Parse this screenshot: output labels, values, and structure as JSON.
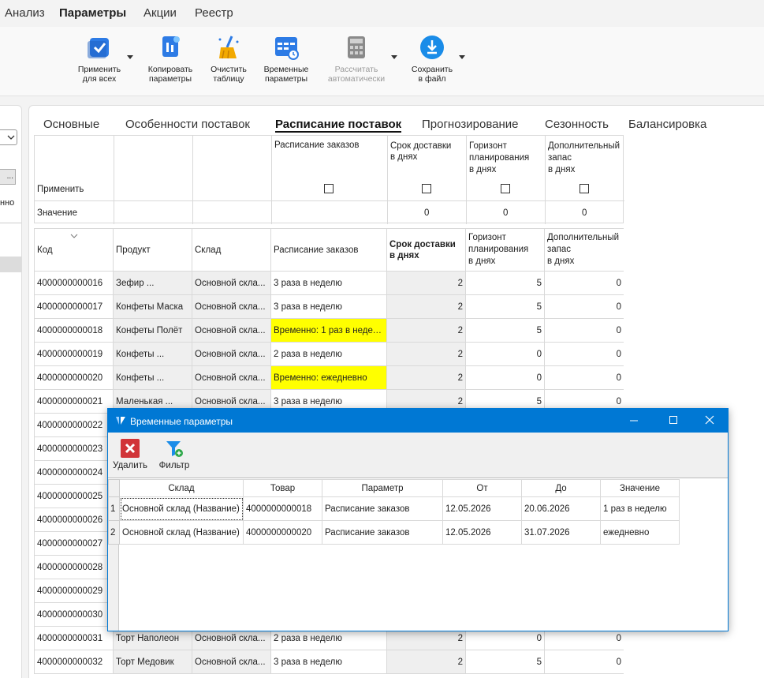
{
  "menu": [
    "Анализ",
    "Параметры",
    "Акции",
    "Реестр"
  ],
  "ribbon": {
    "apply_all": "Применить\nдля всех",
    "copy_params": "Копировать\nпараметры",
    "clear_table": "Очистить\nтаблицу",
    "temp_params": "Временные\nпараметры",
    "calc_auto": "Рассчитать\nавтоматически",
    "save_file": "Сохранить\nв файл"
  },
  "left_panel": {
    "partial_text": "нно"
  },
  "tabs": [
    "Основные",
    "Особенности поставок",
    "Расписание поставок",
    "Прогнозирование",
    "Сезонность",
    "Балансировка"
  ],
  "apply_grid": {
    "col_order_schedule": "Расписание заказов",
    "col_delivery": "Срок доставки\nв днях",
    "col_horizon": "Горизонт\nпланирования\nв днях",
    "col_extra": "Дополнительный\nзапас\nв днях",
    "row_apply": "Применить",
    "row_value": "Значение",
    "values": [
      "0",
      "0",
      "0"
    ]
  },
  "table": {
    "headers": [
      "Код",
      "Продукт",
      "Склад",
      "Расписание заказов",
      "Срок доставки\nв днях",
      "Горизонт\nпланирования\nв днях",
      "Дополнительный\nзапас\nв днях"
    ],
    "rows": [
      {
        "code": "4000000000016",
        "product": "Зефир ...",
        "wh": "Основной скла...",
        "sched": "3 раза в неделю",
        "d": "2",
        "h": "5",
        "e": "0",
        "hl": false
      },
      {
        "code": "4000000000017",
        "product": "Конфеты Маска",
        "wh": "Основной скла...",
        "sched": "3 раза в неделю",
        "d": "2",
        "h": "5",
        "e": "0",
        "hl": false
      },
      {
        "code": "4000000000018",
        "product": "Конфеты Полёт",
        "wh": "Основной скла...",
        "sched": "Временно: 1 раз в неделю",
        "d": "2",
        "h": "5",
        "e": "0",
        "hl": true
      },
      {
        "code": "4000000000019",
        "product": "Конфеты ...",
        "wh": "Основной скла...",
        "sched": "2 раза в неделю",
        "d": "2",
        "h": "0",
        "e": "0",
        "hl": false
      },
      {
        "code": "4000000000020",
        "product": "Конфеты ...",
        "wh": "Основной скла...",
        "sched": "Временно: ежедневно",
        "d": "2",
        "h": "0",
        "e": "0",
        "hl": true
      },
      {
        "code": "4000000000021",
        "product": "Маленькая ...",
        "wh": "Основной скла...",
        "sched": "3 раза в неделю",
        "d": "2",
        "h": "5",
        "e": "0",
        "hl": false
      },
      {
        "code": "4000000000022",
        "product": "",
        "wh": "",
        "sched": "",
        "d": "",
        "h": "",
        "e": "",
        "hl": false
      },
      {
        "code": "4000000000023",
        "product": "",
        "wh": "",
        "sched": "",
        "d": "",
        "h": "",
        "e": "",
        "hl": false
      },
      {
        "code": "4000000000024",
        "product": "",
        "wh": "",
        "sched": "",
        "d": "",
        "h": "",
        "e": "",
        "hl": false
      },
      {
        "code": "4000000000025",
        "product": "",
        "wh": "",
        "sched": "",
        "d": "",
        "h": "",
        "e": "",
        "hl": false
      },
      {
        "code": "4000000000026",
        "product": "",
        "wh": "",
        "sched": "",
        "d": "",
        "h": "",
        "e": "",
        "hl": false
      },
      {
        "code": "4000000000027",
        "product": "",
        "wh": "",
        "sched": "",
        "d": "",
        "h": "",
        "e": "",
        "hl": false
      },
      {
        "code": "4000000000028",
        "product": "",
        "wh": "",
        "sched": "",
        "d": "",
        "h": "",
        "e": "",
        "hl": false
      },
      {
        "code": "4000000000029",
        "product": "",
        "wh": "",
        "sched": "",
        "d": "",
        "h": "",
        "e": "",
        "hl": false
      },
      {
        "code": "4000000000030",
        "product": "",
        "wh": "",
        "sched": "",
        "d": "",
        "h": "",
        "e": "",
        "hl": false
      },
      {
        "code": "4000000000031",
        "product": "Торт Наполеон",
        "wh": "Основной скла...",
        "sched": "2 раза в неделю",
        "d": "2",
        "h": "0",
        "e": "0",
        "hl": false
      },
      {
        "code": "4000000000032",
        "product": "Торт Медовик",
        "wh": "Основной скла...",
        "sched": "3 раза в неделю",
        "d": "2",
        "h": "5",
        "e": "0",
        "hl": false
      }
    ]
  },
  "dialog": {
    "title": "Временные параметры",
    "delete": "Удалить",
    "filter": "Фильтр",
    "headers": [
      "Склад",
      "Товар",
      "Параметр",
      "От",
      "До",
      "Значение"
    ],
    "rows": [
      {
        "n": "1",
        "wh": "Основной склад (Название)",
        "item": "4000000000018",
        "param": "Расписание заказов",
        "from": "12.05.2026",
        "to": "20.06.2026",
        "val": "1 раз в неделю"
      },
      {
        "n": "2",
        "wh": "Основной склад (Название)",
        "item": "4000000000020",
        "param": "Расписание заказов",
        "from": "12.05.2026",
        "to": "31.07.2026",
        "val": "ежедневно"
      }
    ]
  },
  "colors": {
    "accent": "#0078d4",
    "highlight": "#ffff00",
    "delete_red": "#d13438"
  }
}
